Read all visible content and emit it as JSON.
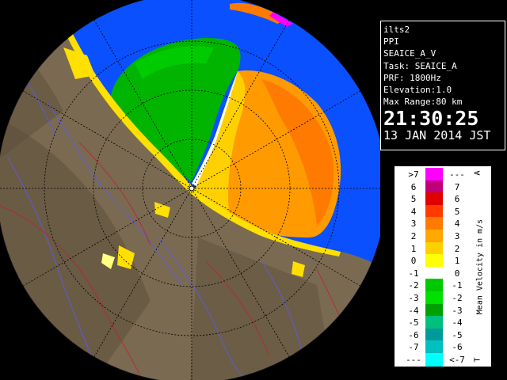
{
  "info": {
    "site": "ilts2",
    "scan_type": "PPI",
    "product": "SEAICE_A_V",
    "task": "Task: SEAICE_A",
    "prf": "PRF: 1800Hz",
    "elevation": "Elevation:1.0",
    "max_range": "Max Range:80 km",
    "time": "21:30:25",
    "date": "13 JAN 2014 JST"
  },
  "legend": {
    "title": "Mean Velocity in m/s",
    "top_letter": "A",
    "bottom_letter": "T",
    "rows": [
      {
        "left": ">7",
        "right": "---",
        "color": "#ff00ff"
      },
      {
        "left": "6",
        "right": "7",
        "color": "#c0007a"
      },
      {
        "left": "5",
        "right": "6",
        "color": "#e00000"
      },
      {
        "left": "4",
        "right": "5",
        "color": "#ff3a00"
      },
      {
        "left": "3",
        "right": "4",
        "color": "#ff7a00"
      },
      {
        "left": "2",
        "right": "3",
        "color": "#ffa800"
      },
      {
        "left": "1",
        "right": "2",
        "color": "#ffd000"
      },
      {
        "left": "0",
        "right": "1",
        "color": "#ffff00"
      },
      {
        "left": "-1",
        "right": "0",
        "color": "#ffffff"
      },
      {
        "left": "-2",
        "right": "-1",
        "color": "#00c800"
      },
      {
        "left": "-3",
        "right": "-2",
        "color": "#00e000"
      },
      {
        "left": "-4",
        "right": "-3",
        "color": "#00a000"
      },
      {
        "left": "-5",
        "right": "-4",
        "color": "#00c080"
      },
      {
        "left": "-6",
        "right": "-5",
        "color": "#009a9a"
      },
      {
        "left": "-7",
        "right": "-6",
        "color": "#00c0c0"
      },
      {
        "left": "---",
        "right": "<-7",
        "color": "#00ffff"
      }
    ]
  },
  "radar": {
    "sea_color": "#0a50ff",
    "land_color": "#7a6a52",
    "range_ring_color": "#000000"
  }
}
